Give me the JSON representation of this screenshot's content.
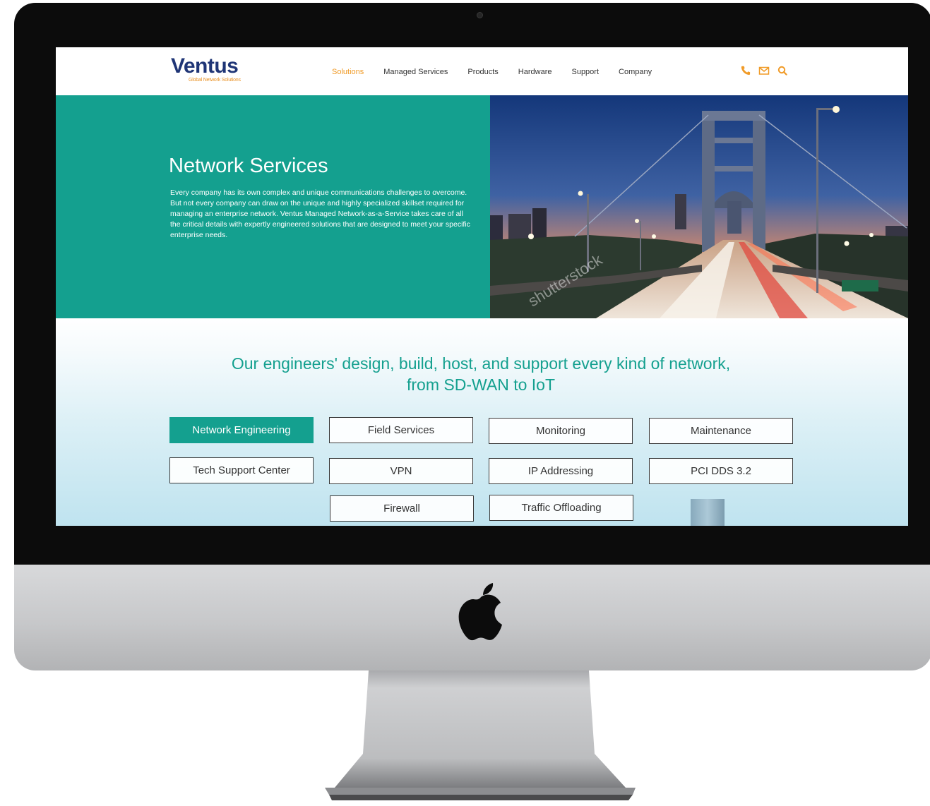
{
  "brand": {
    "name": "Ventus",
    "tagline": "Global Network Solutions",
    "primary_color": "#1f3576",
    "accent_color": "#f09a26",
    "teal_color": "#14a08f"
  },
  "nav": {
    "items": [
      {
        "label": "Solutions",
        "active": true
      },
      {
        "label": "Managed Services",
        "active": false
      },
      {
        "label": "Products",
        "active": false
      },
      {
        "label": "Hardware",
        "active": false
      },
      {
        "label": "Support",
        "active": false
      },
      {
        "label": "Company",
        "active": false
      }
    ]
  },
  "header_icons": [
    "phone-icon",
    "mail-icon",
    "search-icon"
  ],
  "hero": {
    "title": "Network Services",
    "text": "Every company has its own complex and unique communications challenges to overcome. But not every company can draw on the unique and highly specialized skillset required for managing an enterprise network. Ventus Managed Network-as-a-Service takes care of all the critical details with expertly engineered solutions that are designed to meet your specific enterprise needs.",
    "image": "bridge-at-dusk-photo",
    "watermark": "shutterstock"
  },
  "services": {
    "heading_line1": "Our engineers' design, build, host, and support every kind of network,",
    "heading_line2": "from SD-WAN to IoT",
    "buttons": [
      {
        "label": "Network Engineering",
        "active": true
      },
      {
        "label": "Field Services",
        "active": false
      },
      {
        "label": "Monitoring",
        "active": false
      },
      {
        "label": "Maintenance",
        "active": false
      },
      {
        "label": "Tech Support Center",
        "active": false
      },
      {
        "label": "VPN",
        "active": false
      },
      {
        "label": "IP Addressing",
        "active": false
      },
      {
        "label": "PCI DDS 3.2",
        "active": false
      },
      {
        "label": "Firewall",
        "active": false
      },
      {
        "label": "Traffic Offloading",
        "active": false
      }
    ]
  },
  "device": {
    "logo": "apple-logo-icon"
  }
}
